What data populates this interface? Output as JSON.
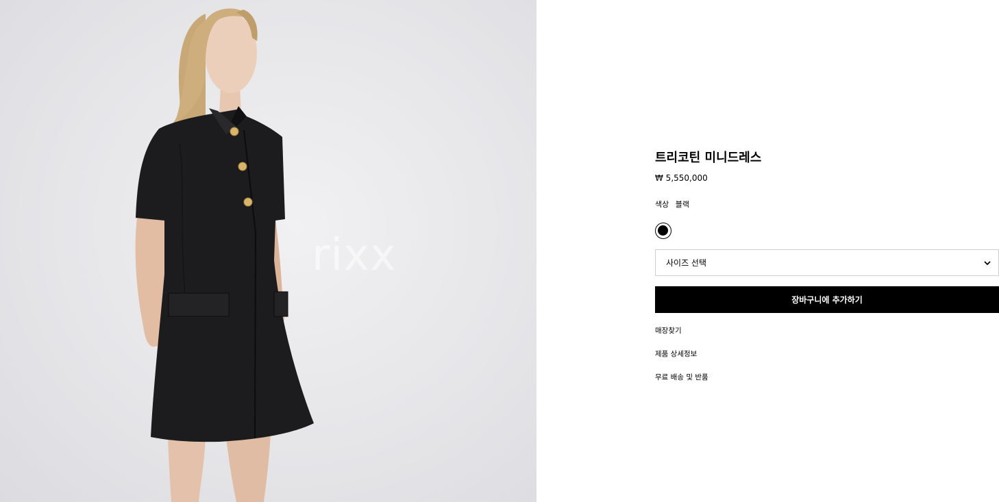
{
  "image": {
    "watermark": "rixx",
    "background_color": "#e6e6e9",
    "dress_color": "#1c1c1e",
    "button_color": "#d8b56a"
  },
  "product": {
    "title": "트리코틴 미니드레스",
    "price": "₩ 5,550,000",
    "color_label": "색상",
    "color_value": "블랙",
    "swatch_color": "#000000",
    "size_select_label": "사이즈 선택",
    "add_to_cart_label": "장바구니에 추가하기",
    "links": [
      "매장찾기",
      "제품 상세정보",
      "무료 배송 및 반품"
    ]
  }
}
